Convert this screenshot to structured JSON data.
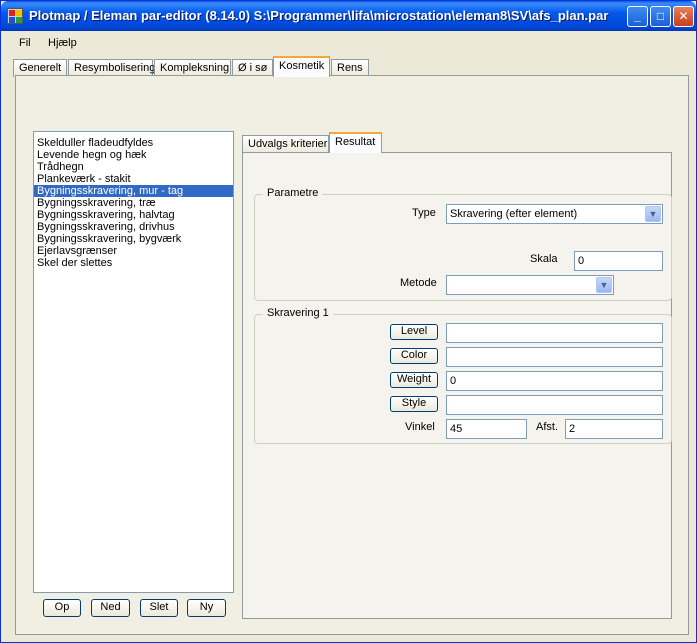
{
  "window": {
    "title": "Plotmap / Eleman par-editor (8.14.0) S:\\Programmer\\lifa\\microstation\\eleman8\\SV\\afs_plan.par",
    "minimize_glyph": "_",
    "maximize_glyph": "□",
    "close_glyph": "✕"
  },
  "menu": {
    "items": [
      "Fil",
      "Hjælp"
    ]
  },
  "main_tabs": [
    "Generelt",
    "Resymbolisering",
    "Kompleksning",
    "Ø i sø",
    "Kosmetik",
    "Rens"
  ],
  "active_main_tab": "Kosmetik",
  "list": {
    "items": [
      "Skelduller fladeudfyldes",
      "Levende hegn og hæk",
      "Trådhegn",
      "Plankeværk - stakit",
      "Bygningsskravering, mur - tag",
      "Bygningsskravering, træ",
      "Bygningsskravering, halvtag",
      "Bygningsskravering, drivhus",
      "Bygningsskravering, bygværk",
      "Ejerlavsgrænser",
      "Skel der slettes"
    ],
    "selected": "Bygningsskravering, mur - tag"
  },
  "list_buttons": {
    "up": "Op",
    "down": "Ned",
    "delete": "Slet",
    "new": "Ny"
  },
  "sub_tabs": [
    "Udvalgs kriterier",
    "Resultat"
  ],
  "active_sub_tab": "Resultat",
  "parametre": {
    "title": "Parametre",
    "type_label": "Type",
    "type_value": "Skravering (efter element)",
    "skala_label": "Skala",
    "skala_value": "0",
    "metode_label": "Metode",
    "metode_value": ""
  },
  "skravering": {
    "title": "Skravering 1",
    "level_label": "Level",
    "level_value": "",
    "color_label": "Color",
    "color_value": "",
    "weight_label": "Weight",
    "weight_value": "0",
    "style_label": "Style",
    "style_value": "",
    "vinkel_label": "Vinkel",
    "vinkel_value": "45",
    "afst_label": "Afst.",
    "afst_value": "2"
  },
  "icons": {
    "dropdown": "chevron-down-icon"
  },
  "colors": {
    "titlebar": "#0058ee",
    "selection": "#316ac5",
    "active_tab_accent": "#f4a838"
  }
}
